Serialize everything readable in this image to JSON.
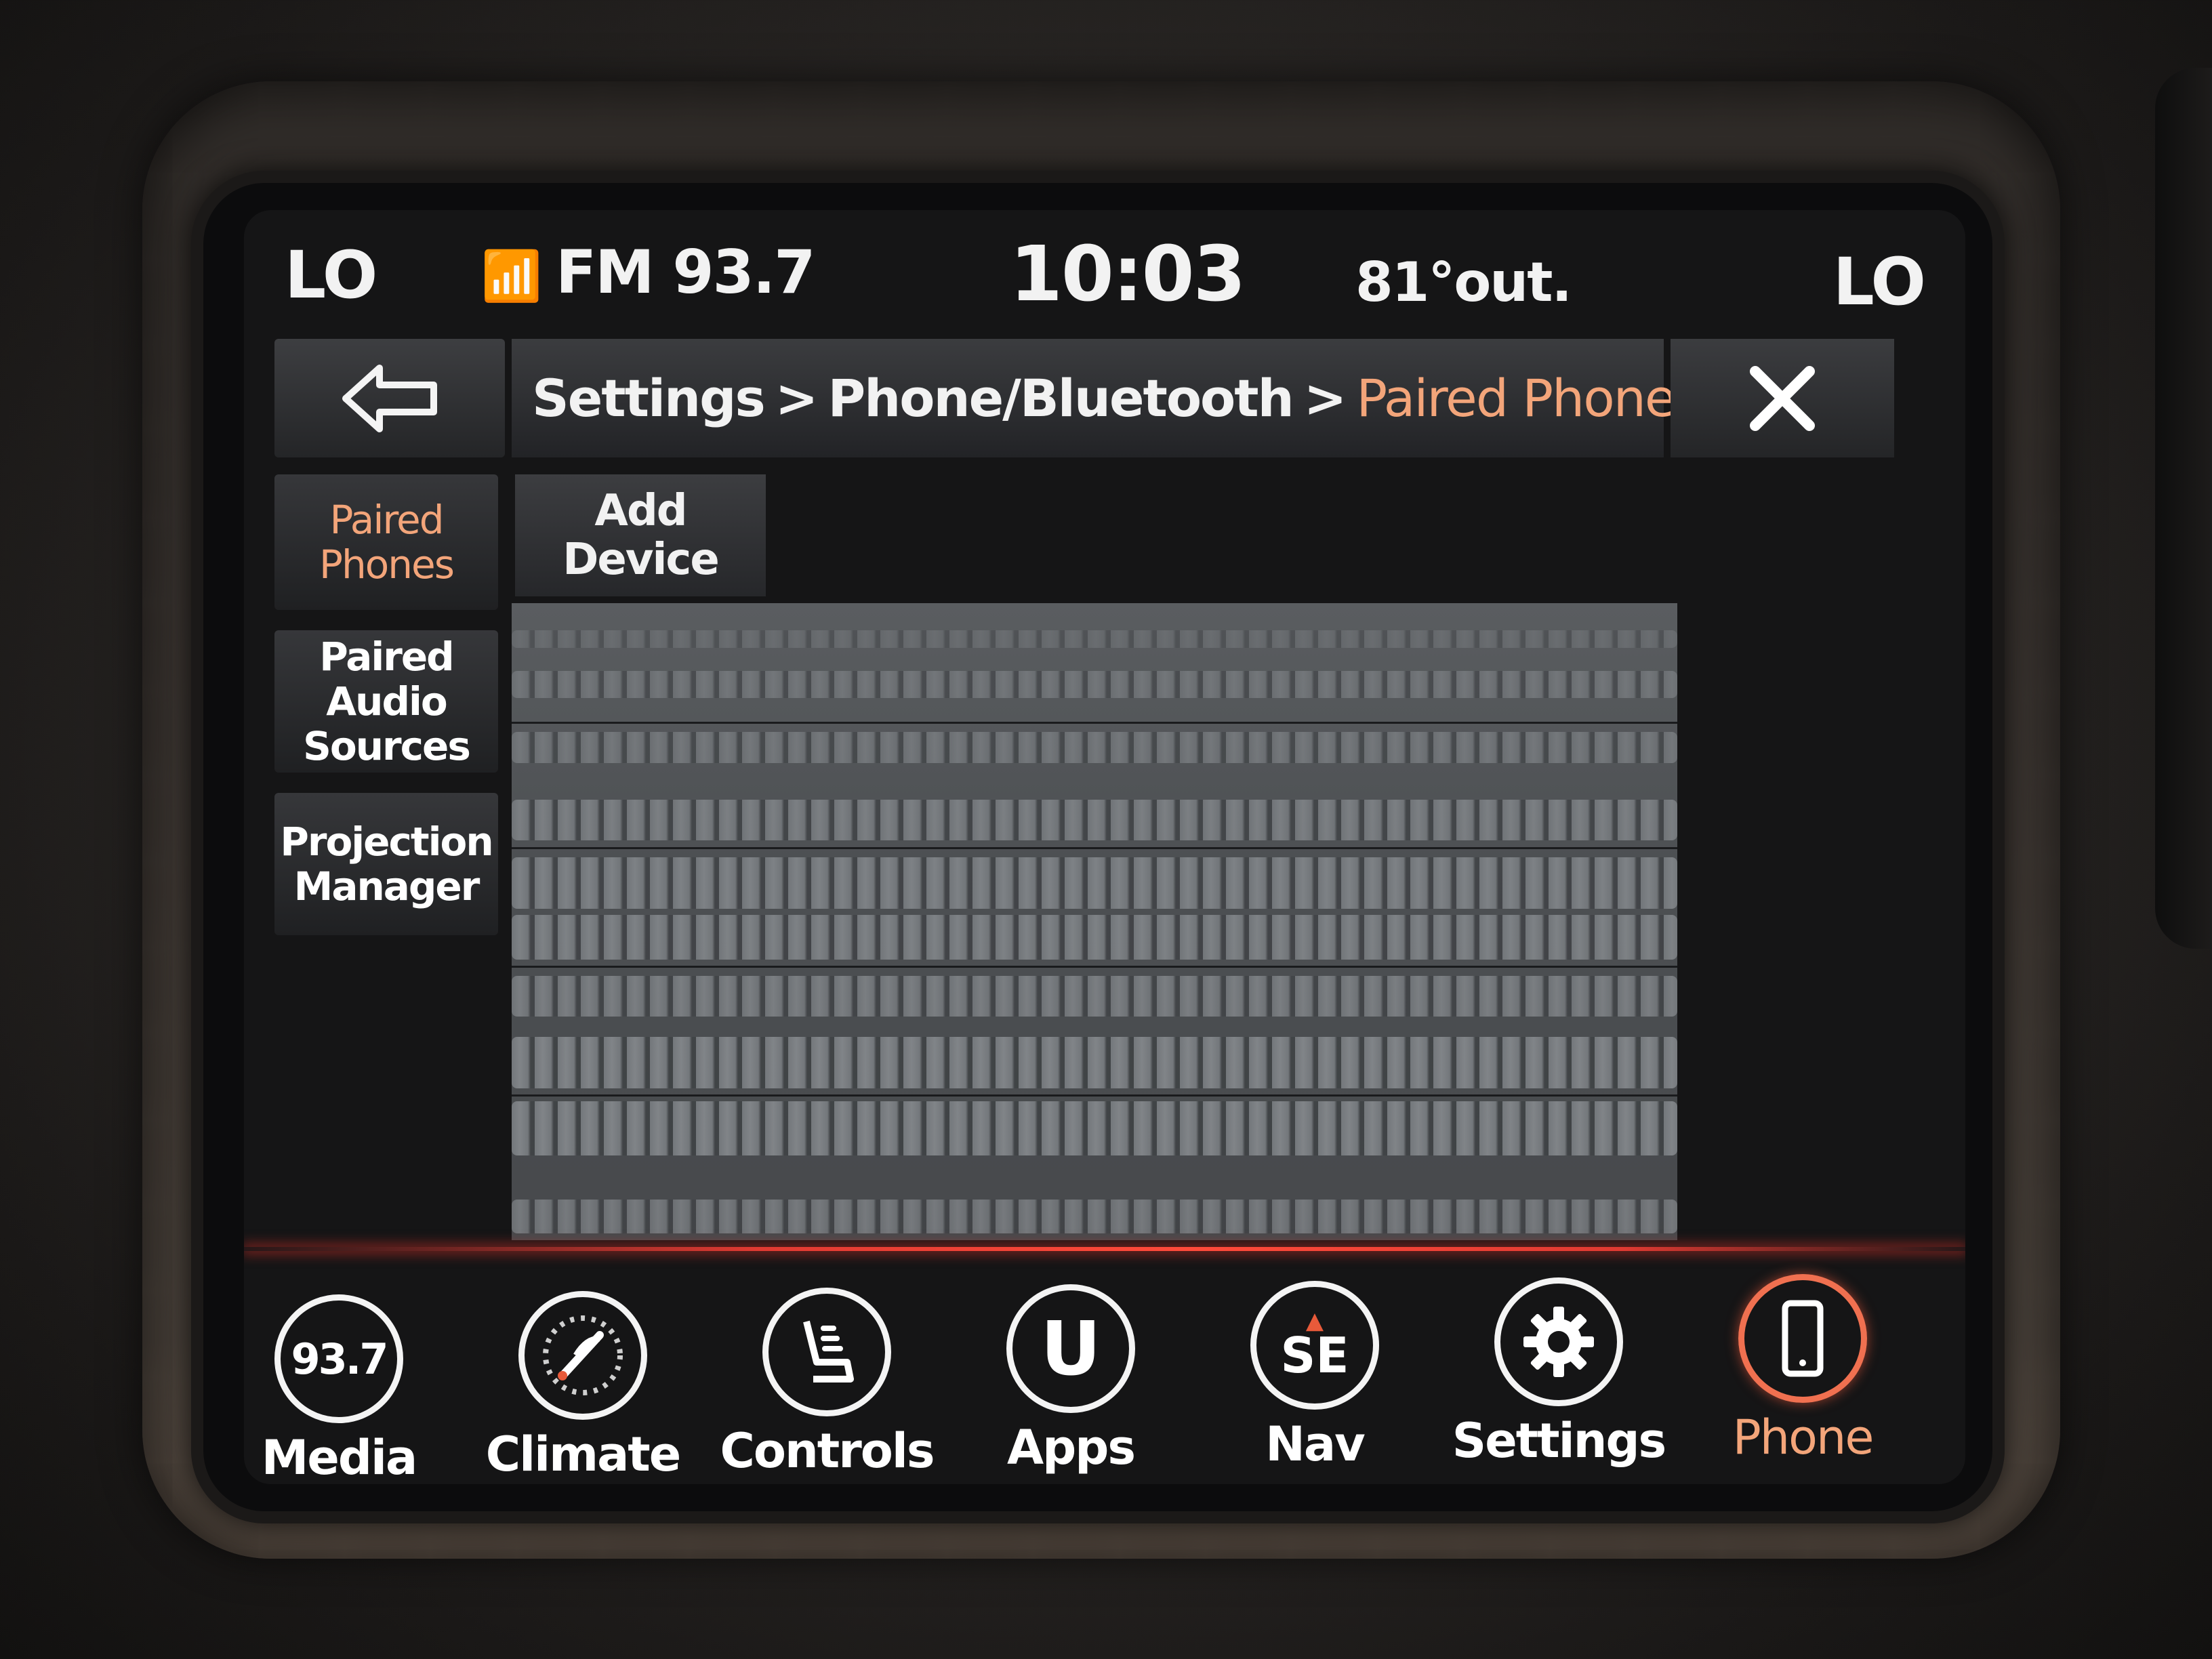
{
  "status_bar": {
    "left_temp": "LO",
    "radio_icon": "📶",
    "radio": "FM 93.7",
    "time": "10:03",
    "outside_temp": "81°out.",
    "right_temp": "LO"
  },
  "header": {
    "back_icon": "⇦",
    "crumb_1": "Settings",
    "crumb_sep": ">",
    "crumb_2": "Phone/Bluetooth",
    "crumb_3": "Paired Phones",
    "close_icon": "✕"
  },
  "sidebar": {
    "items": [
      {
        "line1": "Paired",
        "line2": "Phones",
        "line3": ""
      },
      {
        "line1": "Paired",
        "line2": "Audio",
        "line3": "Sources"
      },
      {
        "line1": "Projection",
        "line2": "Manager",
        "line3": ""
      }
    ]
  },
  "main": {
    "add_device_line1": "Add",
    "add_device_line2": "Device"
  },
  "nav": {
    "media_icon_text": "93.7",
    "media": "Media",
    "climate": "Climate",
    "controls": "Controls",
    "apps_icon_text": "U",
    "apps": "Apps",
    "nav_icon_text": "SE",
    "nav": "Nav",
    "settings": "Settings",
    "phone": "Phone"
  },
  "colors": {
    "accent_orange": "#f3a57a",
    "divider_red": "#e03a32"
  }
}
